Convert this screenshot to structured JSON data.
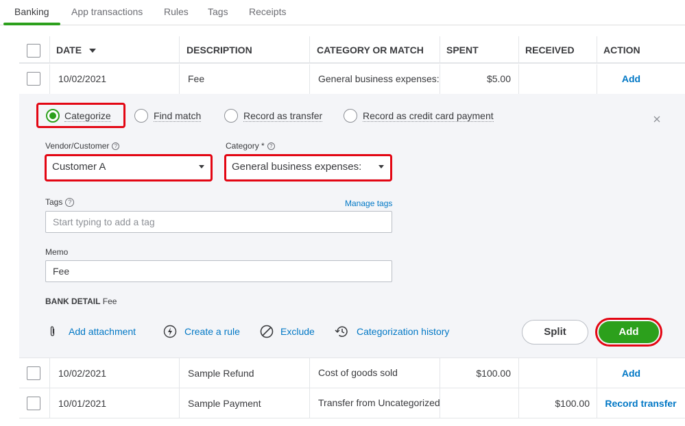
{
  "tabs": [
    {
      "label": "Banking",
      "active": true
    },
    {
      "label": "App transactions",
      "active": false
    },
    {
      "label": "Rules",
      "active": false
    },
    {
      "label": "Tags",
      "active": false
    },
    {
      "label": "Receipts",
      "active": false
    }
  ],
  "table": {
    "headers": {
      "date": "DATE",
      "description": "DESCRIPTION",
      "category": "CATEGORY OR MATCH",
      "spent": "SPENT",
      "received": "RECEIVED",
      "action": "ACTION"
    },
    "sort_icon": "caret-down-icon",
    "rows": [
      {
        "date": "10/02/2021",
        "description": "Fee",
        "category": "General business expenses:Bank fees",
        "spent": "$5.00",
        "received": "",
        "action": "Add"
      },
      {
        "date": "10/02/2021",
        "description": "Sample Refund",
        "category": "Cost of goods sold",
        "spent": "$100.00",
        "received": "",
        "action": "Add"
      },
      {
        "date": "10/01/2021",
        "description": "Sample Payment",
        "category": "Transfer from Uncategorized",
        "spent": "",
        "received": "$100.00",
        "action": "Record transfer"
      }
    ]
  },
  "panel": {
    "options": {
      "categorize": "Categorize",
      "find_match": "Find match",
      "record_transfer": "Record as transfer",
      "record_cc": "Record as credit card payment"
    },
    "close_icon": "close-icon",
    "vendor_label": "Vendor/Customer",
    "vendor_value": "Customer A",
    "category_label": "Category *",
    "category_value": "General business expenses:",
    "tags_label": "Tags",
    "manage_tags": "Manage tags",
    "tags_placeholder": "Start typing to add a tag",
    "memo_label": "Memo",
    "memo_value": "Fee",
    "bank_detail_label": "BANK DETAIL",
    "bank_detail_value": "Fee",
    "actions": {
      "attachment": "Add attachment",
      "rule": "Create a rule",
      "exclude": "Exclude",
      "history": "Categorization history"
    },
    "split_label": "Split",
    "add_label": "Add"
  },
  "colors": {
    "accent_green": "#2ca01c",
    "link_blue": "#0077c5",
    "highlight_red": "#e30613"
  }
}
